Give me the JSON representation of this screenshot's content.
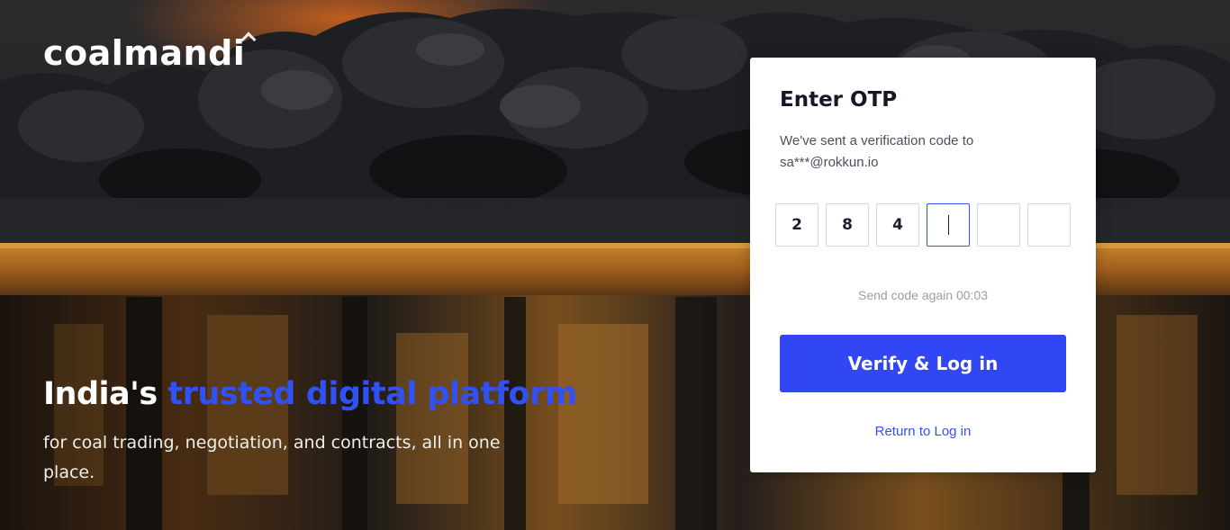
{
  "brand": {
    "logo_text": "coalmandi"
  },
  "hero": {
    "headline_lead": "India's ",
    "headline_highlight": "trusted digital platform",
    "subtext": "for coal trading, negotiation, and contracts, all in one place."
  },
  "otp_card": {
    "title": "Enter OTP",
    "subtitle": "We've sent a verification code to",
    "email": "sa***@rokkun.io",
    "digits": [
      "2",
      "8",
      "4",
      "",
      "",
      ""
    ],
    "active_index": 3,
    "resend_label": "Send code again 00:03",
    "verify_label": "Verify & Log in",
    "return_label": "Return to Log in"
  },
  "colors": {
    "accent": "#3152f2",
    "button": "#3147f5",
    "card_bg": "#ffffff",
    "muted_text": "#9a9ea9"
  },
  "icons": {
    "logo_accent": "caret-up-icon",
    "otp_cursor": "text-cursor-icon"
  }
}
